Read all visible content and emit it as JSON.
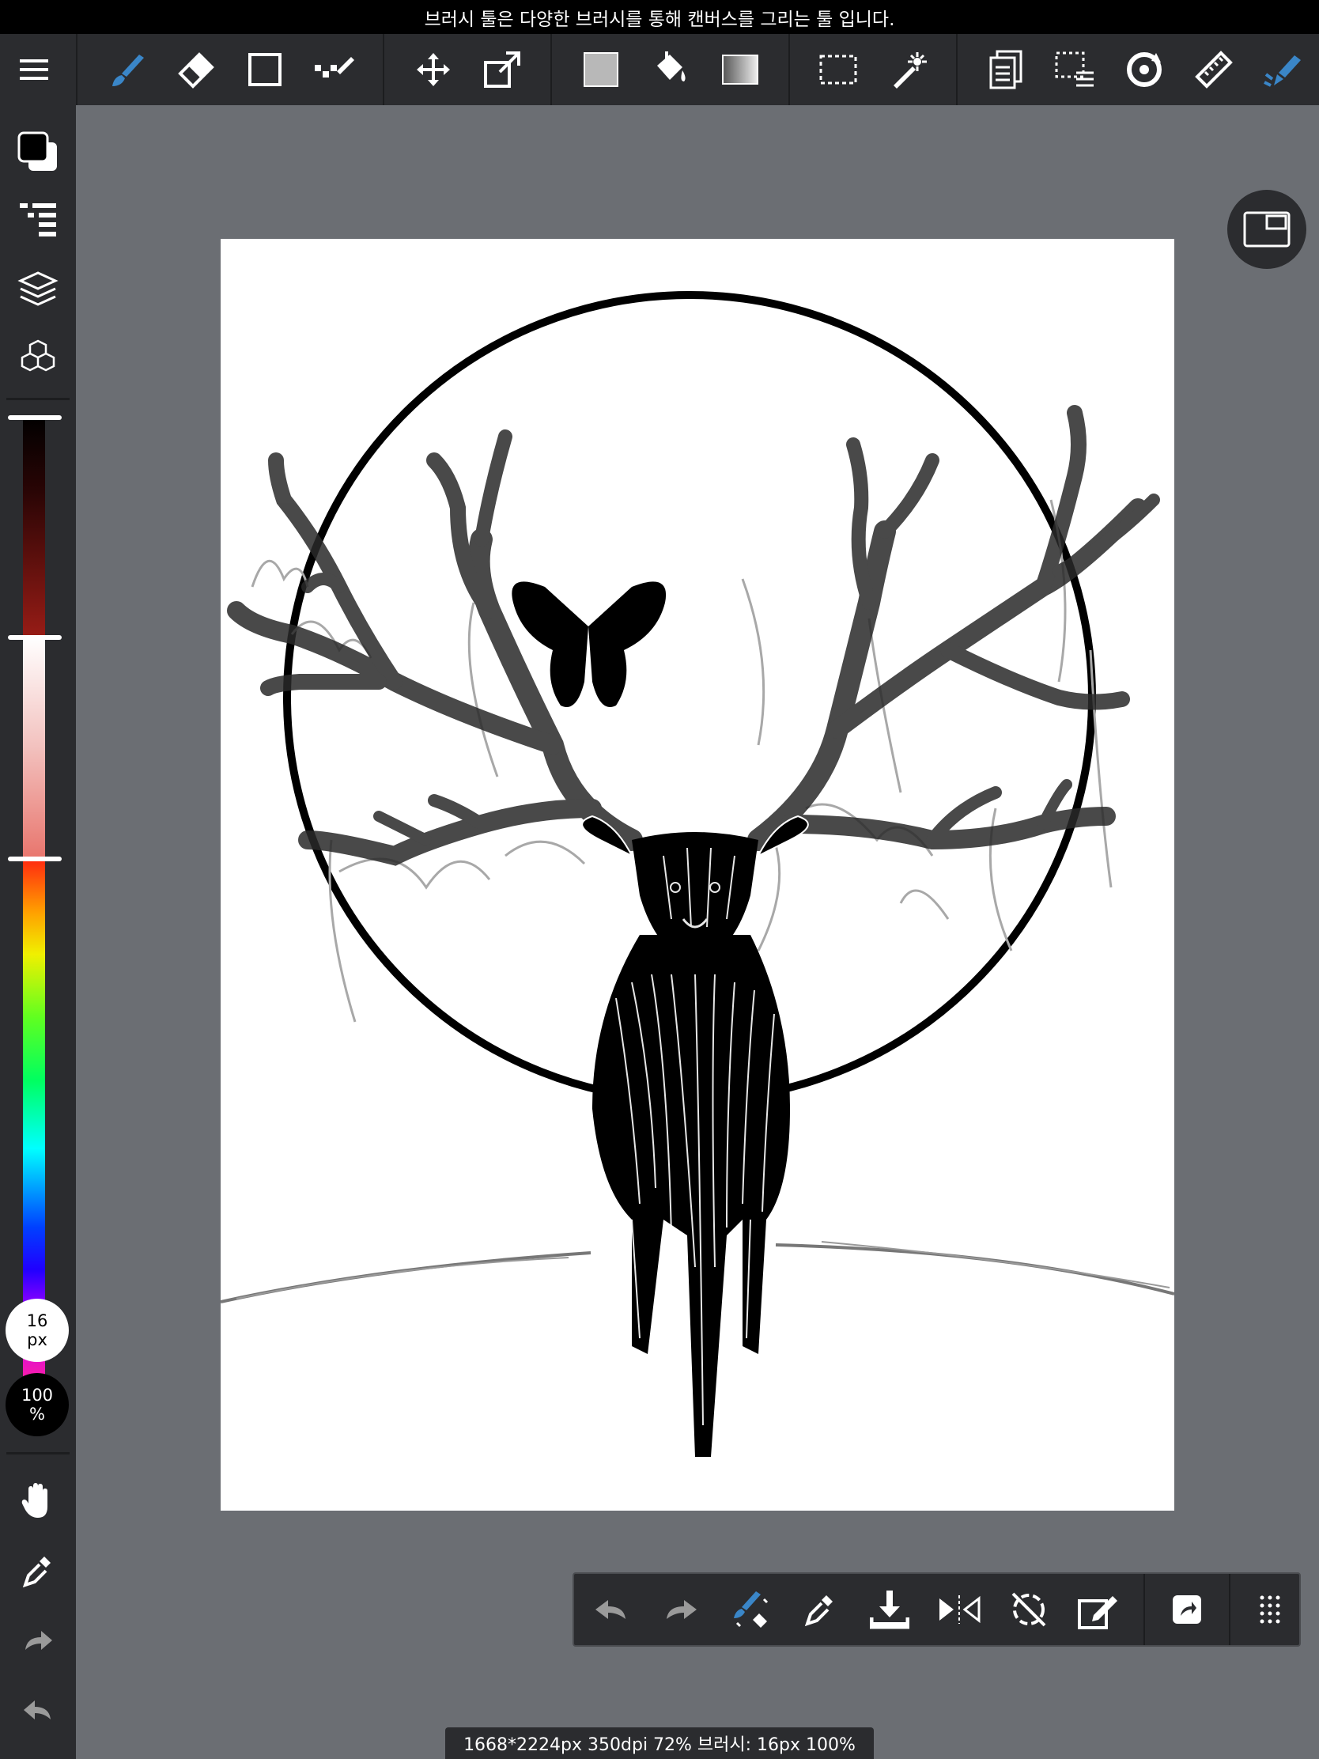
{
  "tip": {
    "text": "브러시 툴은 다양한 브러시를 통해 캔버스를 그리는 툴 입니다."
  },
  "toolbar": {
    "tools": [
      {
        "name": "menu-icon"
      },
      {
        "name": "brush-tool-icon",
        "active": true
      },
      {
        "name": "eraser-tool-icon"
      },
      {
        "name": "shape-tool-icon"
      },
      {
        "name": "dot-tool-icon"
      },
      {
        "name": "move-tool-icon"
      },
      {
        "name": "transform-tool-icon"
      },
      {
        "name": "fill-color-icon"
      },
      {
        "name": "bucket-tool-icon"
      },
      {
        "name": "gradient-tool-icon"
      },
      {
        "name": "select-tool-icon"
      },
      {
        "name": "magic-wand-icon"
      },
      {
        "name": "copy-paste-icon"
      },
      {
        "name": "select-list-icon"
      },
      {
        "name": "rotate-view-icon"
      },
      {
        "name": "ruler-icon"
      },
      {
        "name": "pen-pressure-icon"
      }
    ]
  },
  "sidebar": {
    "brush_size": {
      "value": "16",
      "unit": "px"
    },
    "opacity": {
      "value": "100",
      "unit": "%"
    },
    "color_sliders": {
      "lightness_level": 0.0,
      "saturation_level": 0.0,
      "hue_level": 0.0
    }
  },
  "colors": {
    "accent": "#3a86c8",
    "panel": "#2b2c2f",
    "workspace": "#6b6e73",
    "primary_color": "#000000"
  },
  "status": {
    "text": "1668*2224px 350dpi 72% 브러시: 16px 100%"
  }
}
